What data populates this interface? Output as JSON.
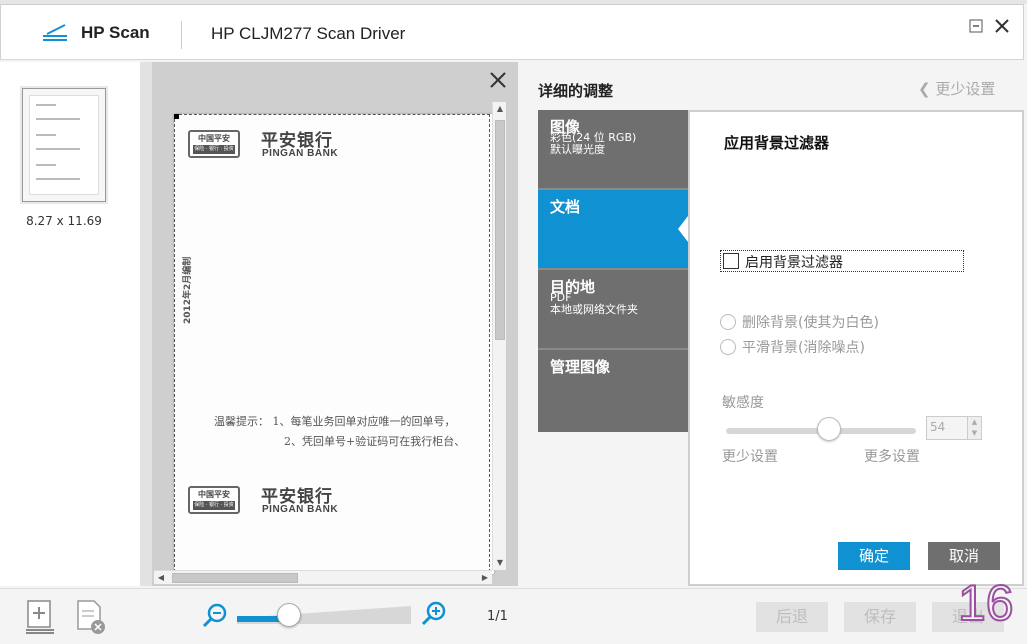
{
  "titlebar": {
    "app_name": "HP Scan",
    "driver_name": "HP CLJM277 Scan Driver"
  },
  "thumbnails": {
    "page_size_label": "8.27 x 11.69"
  },
  "preview": {
    "document": {
      "bank_name_cn": "平安银行",
      "bank_name_en": "PINGAN BANK",
      "logo_text": "中国平安",
      "logo_subtext": "保险 · 银行 · 投资",
      "vertical_note": "2012年2月编制",
      "notice_line1": "温馨提示：  1、每笔业务回单对应唯一的回单号，",
      "notice_line2": "2、凭回单号+验证码可在我行柜台、",
      "bank_name_cn_2": "平安银行",
      "bank_name_en_2": "PINGAN BANK",
      "logo_text_2": "中国平安",
      "logo_subtext_2": "保险 · 银行 · 投资"
    }
  },
  "settings_panel": {
    "title": "详细的调整",
    "less_settings_link": "更少设置",
    "categories": [
      {
        "title": "图像",
        "sub1": "彩色(24 位 RGB)",
        "sub2": "默认曝光度"
      },
      {
        "title": "文档",
        "sub1": "",
        "sub2": ""
      },
      {
        "title": "目的地",
        "sub1": "PDF",
        "sub2": "本地或网络文件夹"
      },
      {
        "title": "管理图像",
        "sub1": "",
        "sub2": ""
      }
    ],
    "active_category": 1,
    "detail": {
      "title": "应用背景过滤器",
      "checkbox_label": "启用背景过滤器",
      "checkbox_checked": false,
      "radio_remove": "删除背景(使其为白色)",
      "radio_smooth": "平滑背景(消除噪点)",
      "sensitivity_label": "敏感度",
      "sensitivity_value": "54",
      "sensitivity_fraction": 0.54,
      "slider_less": "更少设置",
      "slider_more": "更多设置",
      "ok_label": "确定",
      "cancel_label": "取消"
    }
  },
  "bottombar": {
    "page_count": "1/1",
    "zoom_fraction": 0.3,
    "back_label": "后退",
    "save_label": "保存",
    "exit_label": "退出"
  },
  "overlay_number": "16",
  "colors": {
    "accent": "#0f91d2",
    "category_bg": "#6f6f6f",
    "cancel_bg": "#6f6f6f"
  }
}
